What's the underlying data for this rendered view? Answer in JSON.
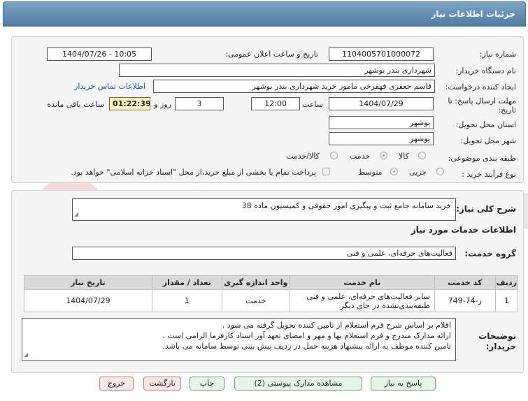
{
  "header": {
    "title": "جزئیات اطلاعات نیاز"
  },
  "form": {
    "need_number_label": "شماره نیاز:",
    "need_number": "1104005701000072",
    "announce_label": "تاریخ و ساعت اعلان عمومی:",
    "announce_value": "1404/07/26 - 10:05",
    "buyer_org_label": "نام دستگاه خریدار:",
    "buyer_org": "شهرداری بندر بوشهر",
    "requester_label": "ایجاد کننده درخواست:",
    "requester": "قاسم جعفری قهفرخی مامور خرید  شهرداری بندر بوشهر",
    "contact_link": "اطلاعات تماس خریدار",
    "deadline_label": "مهلت ارسال پاسخ: تا تاریخ:",
    "deadline_date": "1404/07/29",
    "hour_label": "ساعت",
    "deadline_time": "12:00",
    "days_value": "3",
    "days_label": "روز و",
    "remaining_time": "01:22:39",
    "remaining_label": "ساعت باقی مانده",
    "province_label": "استان محل تحویل:",
    "province": "بوشهر",
    "city_label": "شهر محل تحویل:",
    "city": "بوشهر",
    "category_label": "طبقه بندی موضوعی:",
    "category_options": [
      "کالا",
      "خدمت",
      "کالا/خدمت"
    ],
    "process_label": "نوع فرآیند خرید :",
    "process_options": [
      "جزیی",
      "متوسط"
    ],
    "payment_note": "پرداخت تمام یا بخشی از مبلغ خرید،از محل \"اسناد خزانه اسلامی\" خواهد بود."
  },
  "details": {
    "summary_label": "شرح کلی نیاز:",
    "summary": "خرید سامانه جامع ثبت و پیگیری امور حقوقی و کمیسیون ماده 38",
    "services_title": "اطلاعات خدمات مورد نیاز",
    "group_label": "گروه خدمت:",
    "group_value": "فعالیت‌های حرفه‌ای، علمی و فنی",
    "table": {
      "headers": [
        "ردیف",
        "کد خدمت",
        "نام خدمت",
        "واحد اندازه گیری",
        "تعداد / مقدار",
        "تاریخ نیاز"
      ],
      "rows": [
        [
          "1",
          "ز-74-749",
          "سایر فعالیت‌های حرفه‌ای، علمی و فنی طبقه‌بندی‌نشده در جای دیگر",
          "خدمت",
          "1",
          "1404/07/29"
        ]
      ]
    },
    "notes_label": "توضیحات خریدار:",
    "notes": [
      "اقلام بر اساس شرح فرم استعلام از تامین کننده تحویل گرفته می شود .",
      "ارائه مدارک مندرج و فرم استعلام بها و مهر و امضای تعهد آور اسناد کارفرما الزامی است .",
      "تامین  کننده موظف به ارائه پیشنهاد هزینه حمل در ردیف پیش بینی توسط سامانه می باشد."
    ]
  },
  "buttons": {
    "respond": "پاسخ به نیاز",
    "attachments": "مشاهده مدارک پیوستی (2)",
    "print": "چاپ",
    "back": "بازگشت",
    "exit": "خروج"
  },
  "watermark": "AriaTender.net",
  "colors": {
    "accent": "#5a84ad",
    "timer_bg": "#fbf3c8",
    "link": "#1a56b8"
  }
}
